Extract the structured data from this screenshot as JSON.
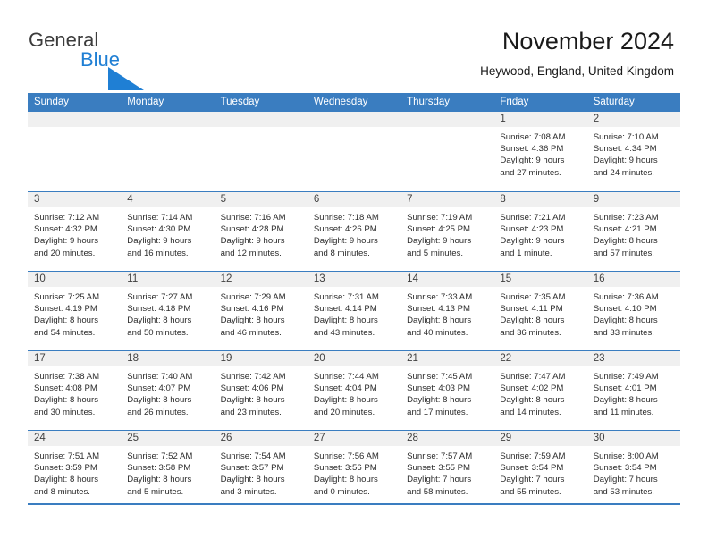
{
  "brand": {
    "name_part1": "General",
    "name_part2": "Blue",
    "logo_icon": "triangle-flag-icon",
    "accent_color": "#1f7fd4"
  },
  "header": {
    "title": "November 2024",
    "location": "Heywood, England, United Kingdom"
  },
  "theme": {
    "header_bar_color": "#3a7dc0",
    "day_header_color": "#f0f0f0",
    "text_color": "#2b2b2b"
  },
  "weekdays": [
    "Sunday",
    "Monday",
    "Tuesday",
    "Wednesday",
    "Thursday",
    "Friday",
    "Saturday"
  ],
  "weeks": [
    [
      {
        "date": "",
        "lines": []
      },
      {
        "date": "",
        "lines": []
      },
      {
        "date": "",
        "lines": []
      },
      {
        "date": "",
        "lines": []
      },
      {
        "date": "",
        "lines": []
      },
      {
        "date": "1",
        "lines": [
          "Sunrise: 7:08 AM",
          "Sunset: 4:36 PM",
          "Daylight: 9 hours",
          "and 27 minutes."
        ]
      },
      {
        "date": "2",
        "lines": [
          "Sunrise: 7:10 AM",
          "Sunset: 4:34 PM",
          "Daylight: 9 hours",
          "and 24 minutes."
        ]
      }
    ],
    [
      {
        "date": "3",
        "lines": [
          "Sunrise: 7:12 AM",
          "Sunset: 4:32 PM",
          "Daylight: 9 hours",
          "and 20 minutes."
        ]
      },
      {
        "date": "4",
        "lines": [
          "Sunrise: 7:14 AM",
          "Sunset: 4:30 PM",
          "Daylight: 9 hours",
          "and 16 minutes."
        ]
      },
      {
        "date": "5",
        "lines": [
          "Sunrise: 7:16 AM",
          "Sunset: 4:28 PM",
          "Daylight: 9 hours",
          "and 12 minutes."
        ]
      },
      {
        "date": "6",
        "lines": [
          "Sunrise: 7:18 AM",
          "Sunset: 4:26 PM",
          "Daylight: 9 hours",
          "and 8 minutes."
        ]
      },
      {
        "date": "7",
        "lines": [
          "Sunrise: 7:19 AM",
          "Sunset: 4:25 PM",
          "Daylight: 9 hours",
          "and 5 minutes."
        ]
      },
      {
        "date": "8",
        "lines": [
          "Sunrise: 7:21 AM",
          "Sunset: 4:23 PM",
          "Daylight: 9 hours",
          "and 1 minute."
        ]
      },
      {
        "date": "9",
        "lines": [
          "Sunrise: 7:23 AM",
          "Sunset: 4:21 PM",
          "Daylight: 8 hours",
          "and 57 minutes."
        ]
      }
    ],
    [
      {
        "date": "10",
        "lines": [
          "Sunrise: 7:25 AM",
          "Sunset: 4:19 PM",
          "Daylight: 8 hours",
          "and 54 minutes."
        ]
      },
      {
        "date": "11",
        "lines": [
          "Sunrise: 7:27 AM",
          "Sunset: 4:18 PM",
          "Daylight: 8 hours",
          "and 50 minutes."
        ]
      },
      {
        "date": "12",
        "lines": [
          "Sunrise: 7:29 AM",
          "Sunset: 4:16 PM",
          "Daylight: 8 hours",
          "and 46 minutes."
        ]
      },
      {
        "date": "13",
        "lines": [
          "Sunrise: 7:31 AM",
          "Sunset: 4:14 PM",
          "Daylight: 8 hours",
          "and 43 minutes."
        ]
      },
      {
        "date": "14",
        "lines": [
          "Sunrise: 7:33 AM",
          "Sunset: 4:13 PM",
          "Daylight: 8 hours",
          "and 40 minutes."
        ]
      },
      {
        "date": "15",
        "lines": [
          "Sunrise: 7:35 AM",
          "Sunset: 4:11 PM",
          "Daylight: 8 hours",
          "and 36 minutes."
        ]
      },
      {
        "date": "16",
        "lines": [
          "Sunrise: 7:36 AM",
          "Sunset: 4:10 PM",
          "Daylight: 8 hours",
          "and 33 minutes."
        ]
      }
    ],
    [
      {
        "date": "17",
        "lines": [
          "Sunrise: 7:38 AM",
          "Sunset: 4:08 PM",
          "Daylight: 8 hours",
          "and 30 minutes."
        ]
      },
      {
        "date": "18",
        "lines": [
          "Sunrise: 7:40 AM",
          "Sunset: 4:07 PM",
          "Daylight: 8 hours",
          "and 26 minutes."
        ]
      },
      {
        "date": "19",
        "lines": [
          "Sunrise: 7:42 AM",
          "Sunset: 4:06 PM",
          "Daylight: 8 hours",
          "and 23 minutes."
        ]
      },
      {
        "date": "20",
        "lines": [
          "Sunrise: 7:44 AM",
          "Sunset: 4:04 PM",
          "Daylight: 8 hours",
          "and 20 minutes."
        ]
      },
      {
        "date": "21",
        "lines": [
          "Sunrise: 7:45 AM",
          "Sunset: 4:03 PM",
          "Daylight: 8 hours",
          "and 17 minutes."
        ]
      },
      {
        "date": "22",
        "lines": [
          "Sunrise: 7:47 AM",
          "Sunset: 4:02 PM",
          "Daylight: 8 hours",
          "and 14 minutes."
        ]
      },
      {
        "date": "23",
        "lines": [
          "Sunrise: 7:49 AM",
          "Sunset: 4:01 PM",
          "Daylight: 8 hours",
          "and 11 minutes."
        ]
      }
    ],
    [
      {
        "date": "24",
        "lines": [
          "Sunrise: 7:51 AM",
          "Sunset: 3:59 PM",
          "Daylight: 8 hours",
          "and 8 minutes."
        ]
      },
      {
        "date": "25",
        "lines": [
          "Sunrise: 7:52 AM",
          "Sunset: 3:58 PM",
          "Daylight: 8 hours",
          "and 5 minutes."
        ]
      },
      {
        "date": "26",
        "lines": [
          "Sunrise: 7:54 AM",
          "Sunset: 3:57 PM",
          "Daylight: 8 hours",
          "and 3 minutes."
        ]
      },
      {
        "date": "27",
        "lines": [
          "Sunrise: 7:56 AM",
          "Sunset: 3:56 PM",
          "Daylight: 8 hours",
          "and 0 minutes."
        ]
      },
      {
        "date": "28",
        "lines": [
          "Sunrise: 7:57 AM",
          "Sunset: 3:55 PM",
          "Daylight: 7 hours",
          "and 58 minutes."
        ]
      },
      {
        "date": "29",
        "lines": [
          "Sunrise: 7:59 AM",
          "Sunset: 3:54 PM",
          "Daylight: 7 hours",
          "and 55 minutes."
        ]
      },
      {
        "date": "30",
        "lines": [
          "Sunrise: 8:00 AM",
          "Sunset: 3:54 PM",
          "Daylight: 7 hours",
          "and 53 minutes."
        ]
      }
    ]
  ]
}
